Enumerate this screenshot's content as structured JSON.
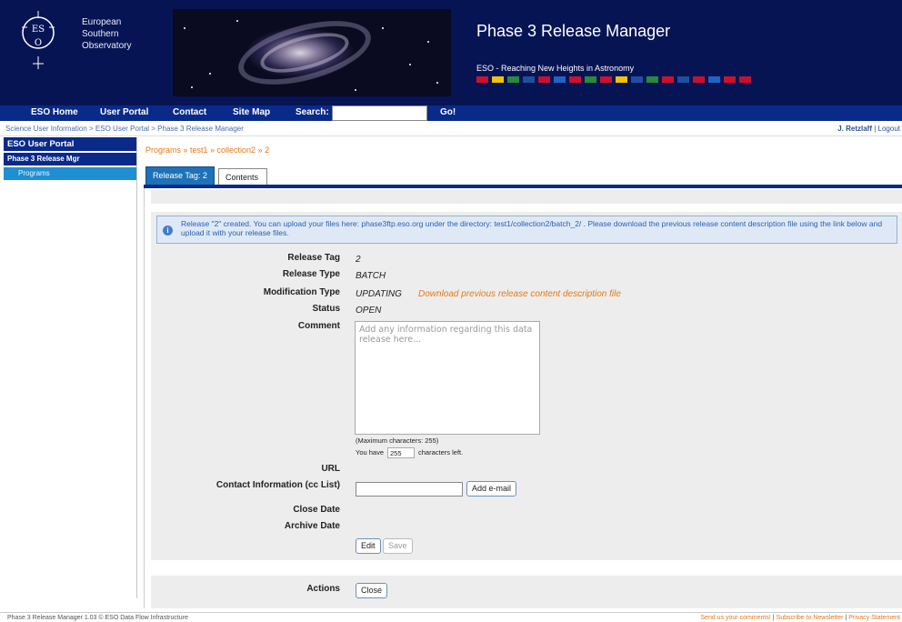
{
  "header": {
    "org_lines": [
      "European",
      "Southern",
      "Observatory"
    ],
    "app_title": "Phase 3 Release Manager",
    "slogan": "ESO - Reaching New Heights in Astronomy",
    "flags": [
      "#d0102a",
      "#f2c400",
      "#2a8a3a",
      "#1f4fa0",
      "#c8102e",
      "#2262c6",
      "#d0102a",
      "#2a8a3a",
      "#d0102a",
      "#f2c400",
      "#1f4fa0",
      "#2a8a3a",
      "#d0102a",
      "#1f4fa0",
      "#c8102e",
      "#2262c6",
      "#d0102a",
      "#c8102e"
    ]
  },
  "nav": {
    "home": "ESO Home",
    "portal": "User Portal",
    "contact": "Contact",
    "sitemap": "Site Map",
    "search_label": "Search:",
    "go": "Go!"
  },
  "breadcrumb": "Science User Information > ESO User Portal > Phase 3 Release Manager",
  "user": {
    "name": "J. Retzlaff",
    "logout": "Logout",
    "sep": " | "
  },
  "sidebar": {
    "portal": "ESO User Portal",
    "manager": "Phase 3 Release Mgr",
    "programs": "Programs"
  },
  "page_crumb": "Programs » test1 » collection2 » 2",
  "tabs": {
    "release": "Release Tag: 2",
    "contents": "Contents"
  },
  "info_message": "Release \"2\" created. You can upload your files here: phase3ftp.eso.org under the directory: test1/collection2/batch_2/ . Please download the previous release content description file using the link below and upload it with your release files.",
  "form": {
    "release_tag_label": "Release Tag",
    "release_tag": "2",
    "release_type_label": "Release Type",
    "release_type": "BATCH",
    "modification_type_label": "Modification Type",
    "modification_type": "UPDATING",
    "download_link": "Download previous release content description file",
    "status_label": "Status",
    "status": "OPEN",
    "comment_label": "Comment",
    "comment_placeholder": "Add any information regarding this data release here...",
    "max_chars": "(Maximum characters: 255)",
    "chars_prefix": "You have",
    "chars_left": "255",
    "chars_suffix": "characters left.",
    "url_label": "URL",
    "contact_label": "Contact Information (cc List)",
    "add_email": "Add e-mail",
    "close_date_label": "Close Date",
    "archive_date_label": "Archive Date",
    "edit": "Edit",
    "save": "Save"
  },
  "actions": {
    "label": "Actions",
    "close": "Close"
  },
  "footer": {
    "left": "Phase 3 Release Manager 1.03 © ESO Data Flow Infrastructure",
    "comments": "Send us your comments!",
    "newsletter": "Subscribe to Newsletter",
    "privacy": "Privacy Statement",
    "sep": " | "
  }
}
